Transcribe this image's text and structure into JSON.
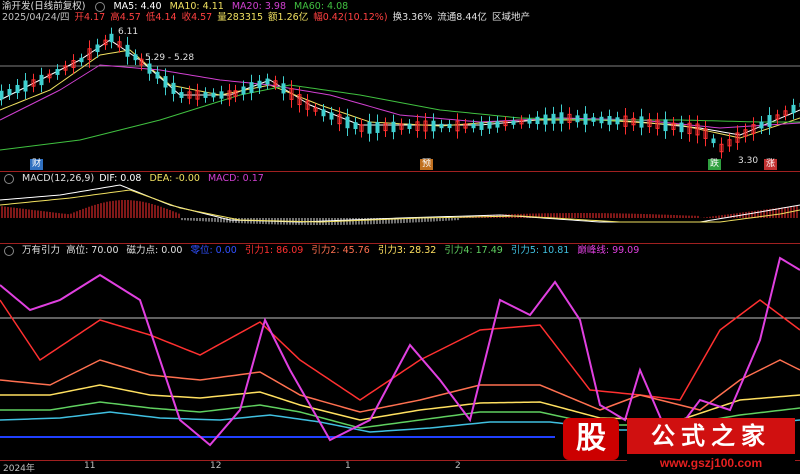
{
  "header": {
    "stock": "渝开发(日线前复权)",
    "ma5": "MA5: 4.40",
    "ma10": "MA10: 4.11",
    "ma20": "MA20: 3.98",
    "ma60": "MA60: 4.08",
    "date": "2025/04/24/四",
    "open": "开4.17",
    "high": "高4.57",
    "low": "低4.14",
    "close": "收4.57",
    "volume": "量283315",
    "amount": "额1.26亿",
    "change": "幅0.42(10.12%)",
    "turnover": "换3.36%",
    "float": "流通8.44亿",
    "sector": "区域地产"
  },
  "price_panel": {
    "high_label": "6.11",
    "range_label": "5.29 - 5.28",
    "low_label": "3.30",
    "markers": [
      "财",
      "预",
      "跌",
      "涨"
    ]
  },
  "macd": {
    "title": "MACD(12,26,9)",
    "dif": "DIF: 0.08",
    "dea": "DEA: -0.00",
    "macd": "MACD: 0.17"
  },
  "indicator": {
    "title": "万有引力",
    "high_pos": "高位: 70.00",
    "magnet": "磁力点: 0.00",
    "zero": "零位: 0.00",
    "g1": "引力1: 86.09",
    "g2": "引力2: 45.76",
    "g3": "引力3: 28.32",
    "g4": "引力4: 17.49",
    "g5": "引力5: 10.81",
    "apex": "巅峰线: 99.09"
  },
  "x_axis": [
    "2024年",
    "11",
    "12",
    "1",
    "2"
  ],
  "watermark": {
    "logo": "股",
    "name": "公式之家",
    "url": "www.gszj100.com"
  },
  "colors": {
    "ma5": "#ffffff",
    "ma10": "#f0e060",
    "ma20": "#d040d0",
    "ma60": "#40c040",
    "up": "#ff3030",
    "down": "#40d0d0",
    "apex": "#e040e0"
  }
}
